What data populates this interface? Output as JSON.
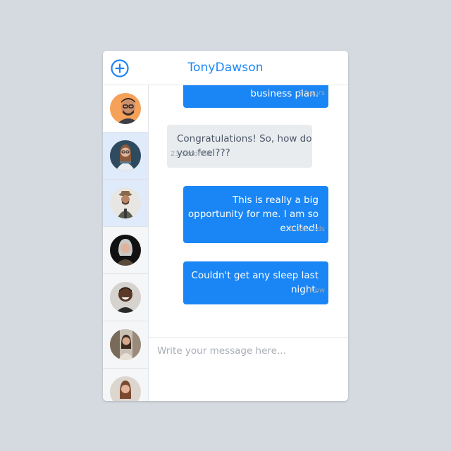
{
  "header": {
    "title": "TonyDawson",
    "add_icon": "plus-circle-icon",
    "accent": "#1a86f5"
  },
  "sidebar": {
    "contacts": [
      {
        "avatar": "avatar-man-glasses",
        "bg": "#f5a15a",
        "selected": false
      },
      {
        "avatar": "avatar-woman-glasses",
        "bg": "#2e4a5e",
        "selected": true
      },
      {
        "avatar": "avatar-man-hat",
        "bg": "#e8e6e2",
        "selected": true
      },
      {
        "avatar": "avatar-woman-grey-hair",
        "bg": "#111111",
        "selected": false
      },
      {
        "avatar": "avatar-man-smiling",
        "bg": "#d6d3cf",
        "selected": false
      },
      {
        "avatar": "avatar-woman-street",
        "bg": "#c9c1b6",
        "selected": false
      },
      {
        "avatar": "avatar-woman-partial",
        "bg": "#ddd6cf",
        "selected": false
      }
    ]
  },
  "messages": [
    {
      "direction": "out",
      "lines": [
        "business plan."
      ],
      "time": "2 hours"
    },
    {
      "direction": "in",
      "lines": [
        "Congratulations! So, how do",
        "you feel???"
      ],
      "time": "23 seconds"
    },
    {
      "direction": "out",
      "lines": [
        "This is really a big",
        "opportunity for me. I am so",
        "excited!"
      ],
      "time": "5 seconds"
    },
    {
      "direction": "out",
      "lines": [
        "Couldn't get any sleep last",
        "night."
      ],
      "time": "Now"
    }
  ],
  "composer": {
    "placeholder": "Write your message here...",
    "value": ""
  }
}
